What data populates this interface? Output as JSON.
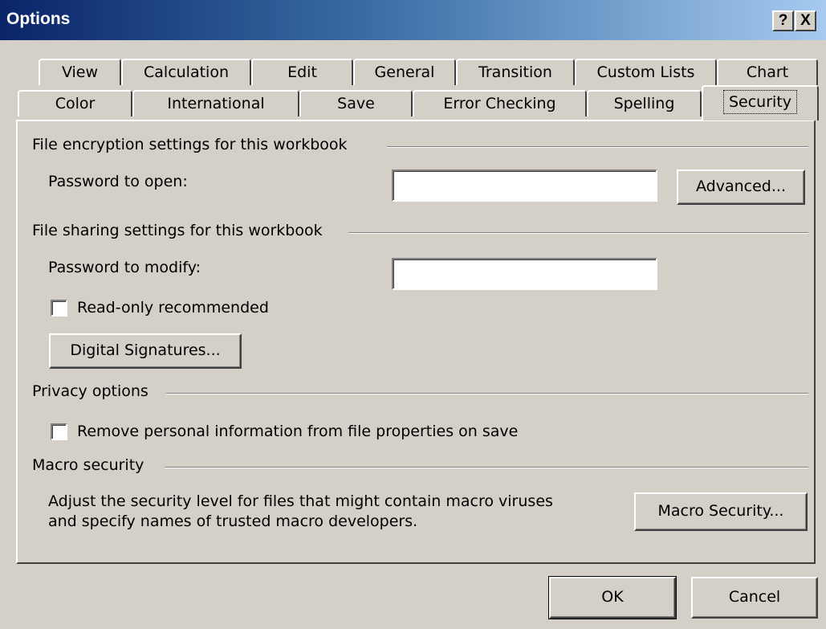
{
  "window": {
    "title": "Options",
    "help_button": "?",
    "close_button": "X"
  },
  "tabs_row1": [
    "View",
    "Calculation",
    "Edit",
    "General",
    "Transition",
    "Custom Lists",
    "Chart"
  ],
  "tabs_row2": [
    "Color",
    "International",
    "Save",
    "Error Checking",
    "Spelling",
    "Security"
  ],
  "active_tab": "Security",
  "encryption": {
    "title": "File encryption settings for this workbook",
    "password_label": "Password to open:",
    "password_value": "",
    "advanced_button": "Advanced..."
  },
  "sharing": {
    "title": "File sharing settings for this workbook",
    "password_label": "Password to modify:",
    "password_value": "",
    "readonly_label": "Read-only recommended",
    "readonly_checked": false,
    "signatures_button": "Digital Signatures..."
  },
  "privacy": {
    "title": "Privacy options",
    "remove_info_label": "Remove personal information from file properties on save",
    "remove_info_checked": false
  },
  "macro": {
    "title": "Macro security",
    "description_line1": "Adjust the security level for files that might contain macro viruses",
    "description_line2": "and specify names of trusted macro developers.",
    "button": "Macro Security..."
  },
  "footer": {
    "ok_button": "OK",
    "cancel_button": "Cancel"
  }
}
